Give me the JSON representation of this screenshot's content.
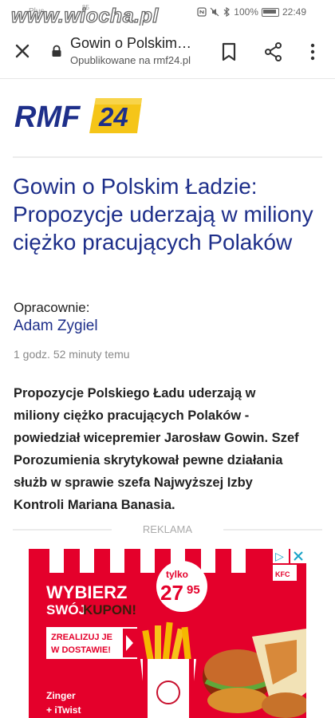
{
  "status_bar": {
    "carrier": "Plus",
    "signal_percent": "85",
    "watermark": "www.wiocha.pl",
    "battery": "100%",
    "time": "22:49"
  },
  "browser": {
    "page_title": "Gowin o Polskim…",
    "url_line": "Opublikowane na rmf24.pl"
  },
  "site": {
    "logo_text": "RMF",
    "logo_badge": "24"
  },
  "article": {
    "headline": "Gowin o Polskim Ładzie: Propozycje uderzają w miliony ciężko pracujących Polaków",
    "author_label": "Opracownie:",
    "author_name": "Adam Zygiel",
    "published": "1 godz. 52 minuty temu",
    "lead": "Propozycje Polskiego Ładu uderzają w miliony ciężko pracujących Polaków - powiedział wicepremier Jarosław Gowin. Szef Porozumienia skrytykował pewne działania służb w sprawie szefa Najwyższej Izby Kontroli Mariana Banasia."
  },
  "ad": {
    "label": "REKLAMA",
    "headline_1": "WYBIERZ",
    "headline_2": "SWÓJ",
    "headline_3": "KUPON!",
    "price_prefix": "tylko",
    "price_main": "27",
    "price_cents": "95",
    "cta_1": "ZREALIZUJ JE",
    "cta_2": "W DOSTAWIE!",
    "product_1": "Zinger",
    "product_2": "+ iTwist",
    "brand": "KFC",
    "adchoices": "▷"
  },
  "colors": {
    "brand_blue": "#1e2f8a",
    "brand_yellow": "#f5c518",
    "ad_red": "#e4002b"
  }
}
